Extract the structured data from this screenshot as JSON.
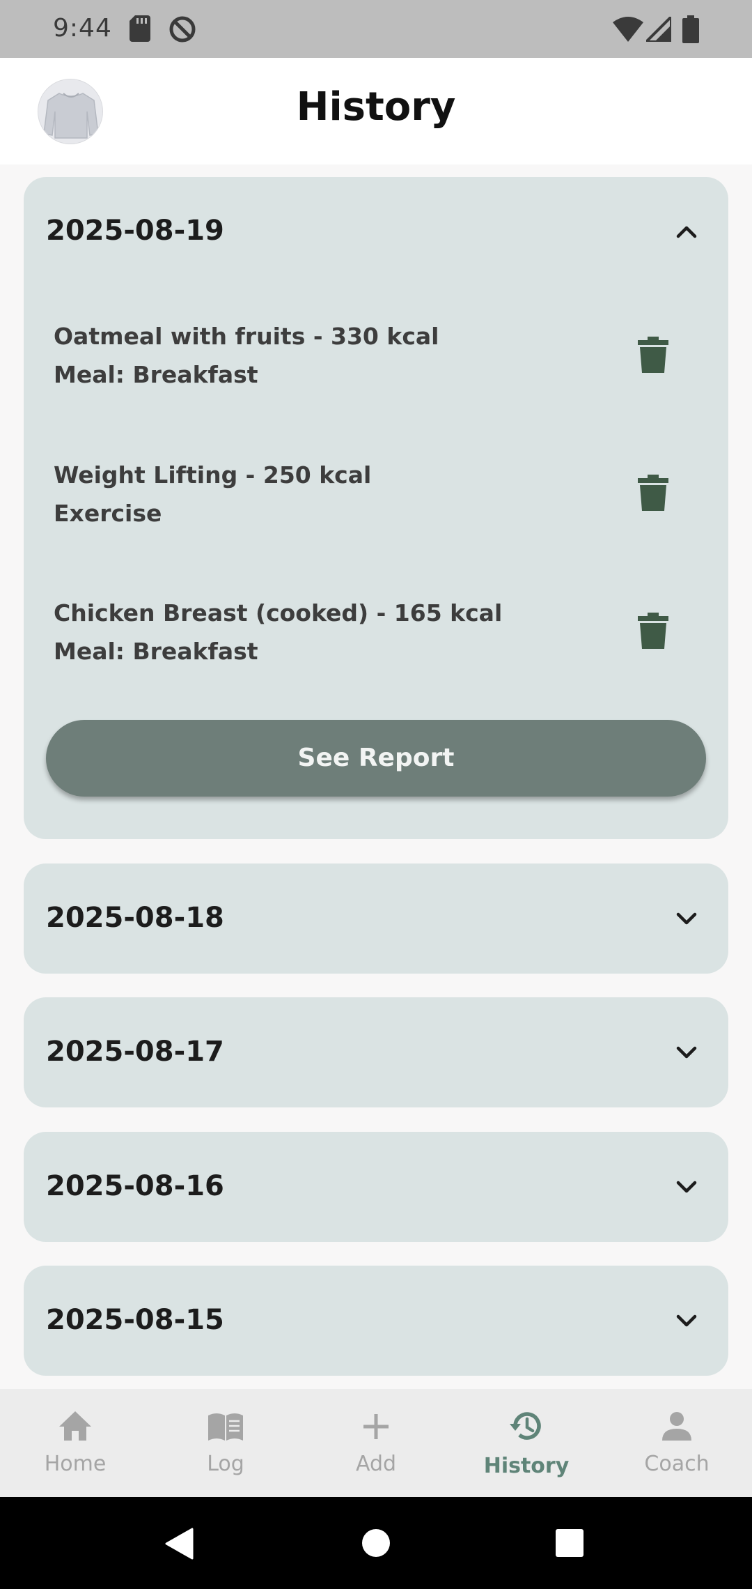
{
  "status_bar": {
    "time": "9:44",
    "icons": [
      "sd-card-icon",
      "do-not-disturb-icon",
      "wifi-icon",
      "signal-icon",
      "battery-icon"
    ]
  },
  "app_bar": {
    "title": "History",
    "avatar": "profile-avatar"
  },
  "history": {
    "expanded_day": {
      "date": "2025-08-19",
      "entries": [
        {
          "line1": "Oatmeal with fruits - 330 kcal",
          "line2": "Meal: Breakfast"
        },
        {
          "line1": "Weight Lifting - 250 kcal",
          "line2": "Exercise"
        },
        {
          "line1": "Chicken Breast (cooked) - 165 kcal",
          "line2": "Meal: Breakfast"
        }
      ],
      "report_button": "See Report"
    },
    "collapsed_days": [
      "2025-08-18",
      "2025-08-17",
      "2025-08-16",
      "2025-08-15"
    ]
  },
  "bottom_nav": {
    "items": [
      {
        "label": "Home",
        "icon": "home-icon"
      },
      {
        "label": "Log",
        "icon": "book-icon"
      },
      {
        "label": "Add",
        "icon": "plus-icon"
      },
      {
        "label": "History",
        "icon": "history-icon"
      },
      {
        "label": "Coach",
        "icon": "person-icon"
      }
    ],
    "active": "History"
  },
  "colors": {
    "card_bg": "#dae3e3",
    "button": "#6e7e79",
    "trash": "#3f5a46",
    "active_nav": "#5f8478"
  }
}
